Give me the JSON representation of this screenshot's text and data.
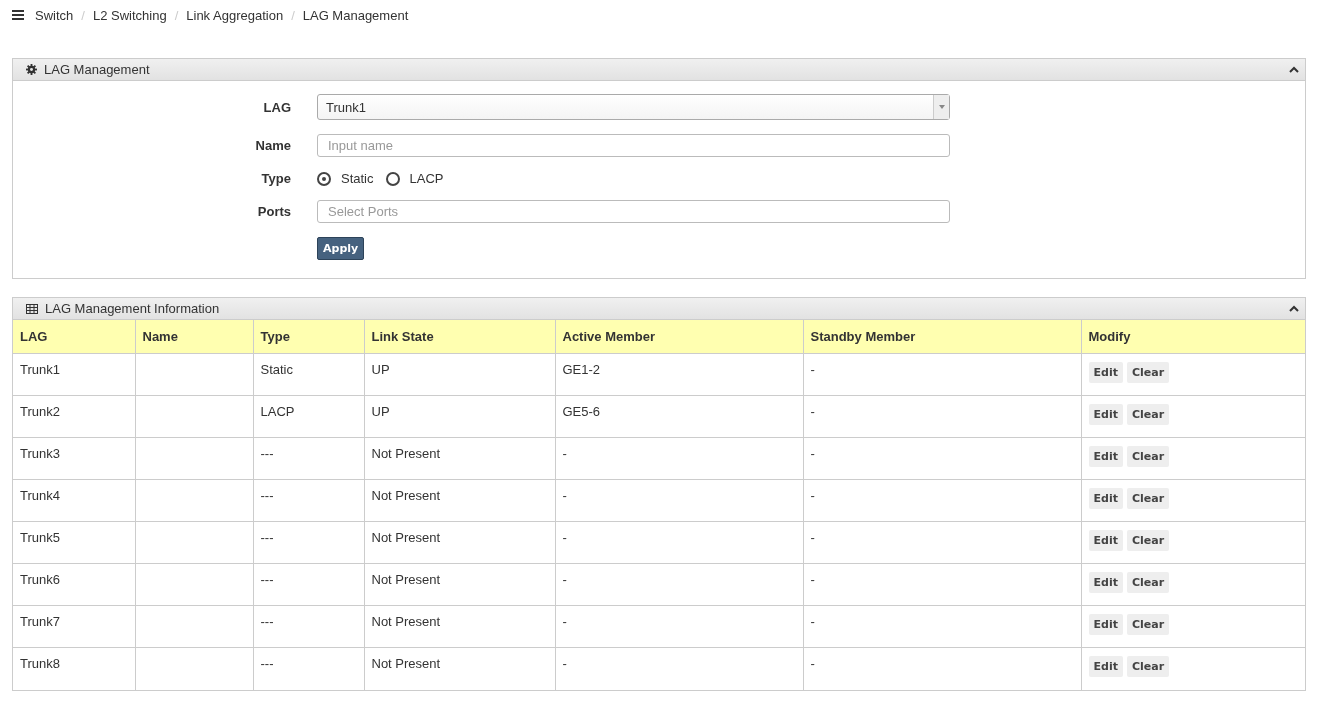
{
  "breadcrumb": [
    "Switch",
    "L2 Switching",
    "Link Aggregation",
    "LAG Management"
  ],
  "breadcrumb_separator": "/",
  "config_panel": {
    "title": "LAG Management",
    "fields": [
      {
        "kind": "select",
        "label": "LAG",
        "value": "Trunk1"
      },
      {
        "kind": "text",
        "label": "Name",
        "placeholder": "Input name"
      },
      {
        "kind": "radio",
        "label": "Type",
        "options": [
          {
            "label": "Static",
            "selected": true
          },
          {
            "label": "LACP",
            "selected": false
          }
        ]
      },
      {
        "kind": "text",
        "label": "Ports",
        "placeholder": "Select Ports"
      }
    ],
    "apply_button": "Apply"
  },
  "info_panel": {
    "title": "LAG Management Information",
    "table": {
      "columns": [
        "LAG",
        "Name",
        "Type",
        "Link State",
        "Active Member",
        "Standby Member",
        "Modify"
      ],
      "rows": [
        {
          "lag": "Trunk1",
          "type": "Static",
          "link_state": "UP",
          "active_member": "GE1-2",
          "standby_member": "-",
          "actions": [
            "Edit",
            "Clear"
          ]
        },
        {
          "lag": "Trunk2",
          "type": "LACP",
          "link_state": "UP",
          "active_member": "GE5-6",
          "standby_member": "-",
          "actions": [
            "Edit",
            "Clear"
          ]
        },
        {
          "lag": "Trunk3",
          "type": "---",
          "link_state": "Not Present",
          "active_member": "-",
          "standby_member": "-",
          "actions": [
            "Edit",
            "Clear"
          ]
        },
        {
          "lag": "Trunk4",
          "type": "---",
          "link_state": "Not Present",
          "active_member": "-",
          "standby_member": "-",
          "actions": [
            "Edit",
            "Clear"
          ]
        },
        {
          "lag": "Trunk5",
          "type": "---",
          "link_state": "Not Present",
          "active_member": "-",
          "standby_member": "-",
          "actions": [
            "Edit",
            "Clear"
          ]
        },
        {
          "lag": "Trunk6",
          "type": "---",
          "link_state": "Not Present",
          "active_member": "-",
          "standby_member": "-",
          "actions": [
            "Edit",
            "Clear"
          ]
        },
        {
          "lag": "Trunk7",
          "type": "---",
          "link_state": "Not Present",
          "active_member": "-",
          "standby_member": "-",
          "actions": [
            "Edit",
            "Clear"
          ]
        },
        {
          "lag": "Trunk8",
          "type": "---",
          "link_state": "Not Present",
          "active_member": "-",
          "standby_member": "-",
          "actions": [
            "Edit",
            "Clear"
          ]
        }
      ]
    }
  }
}
